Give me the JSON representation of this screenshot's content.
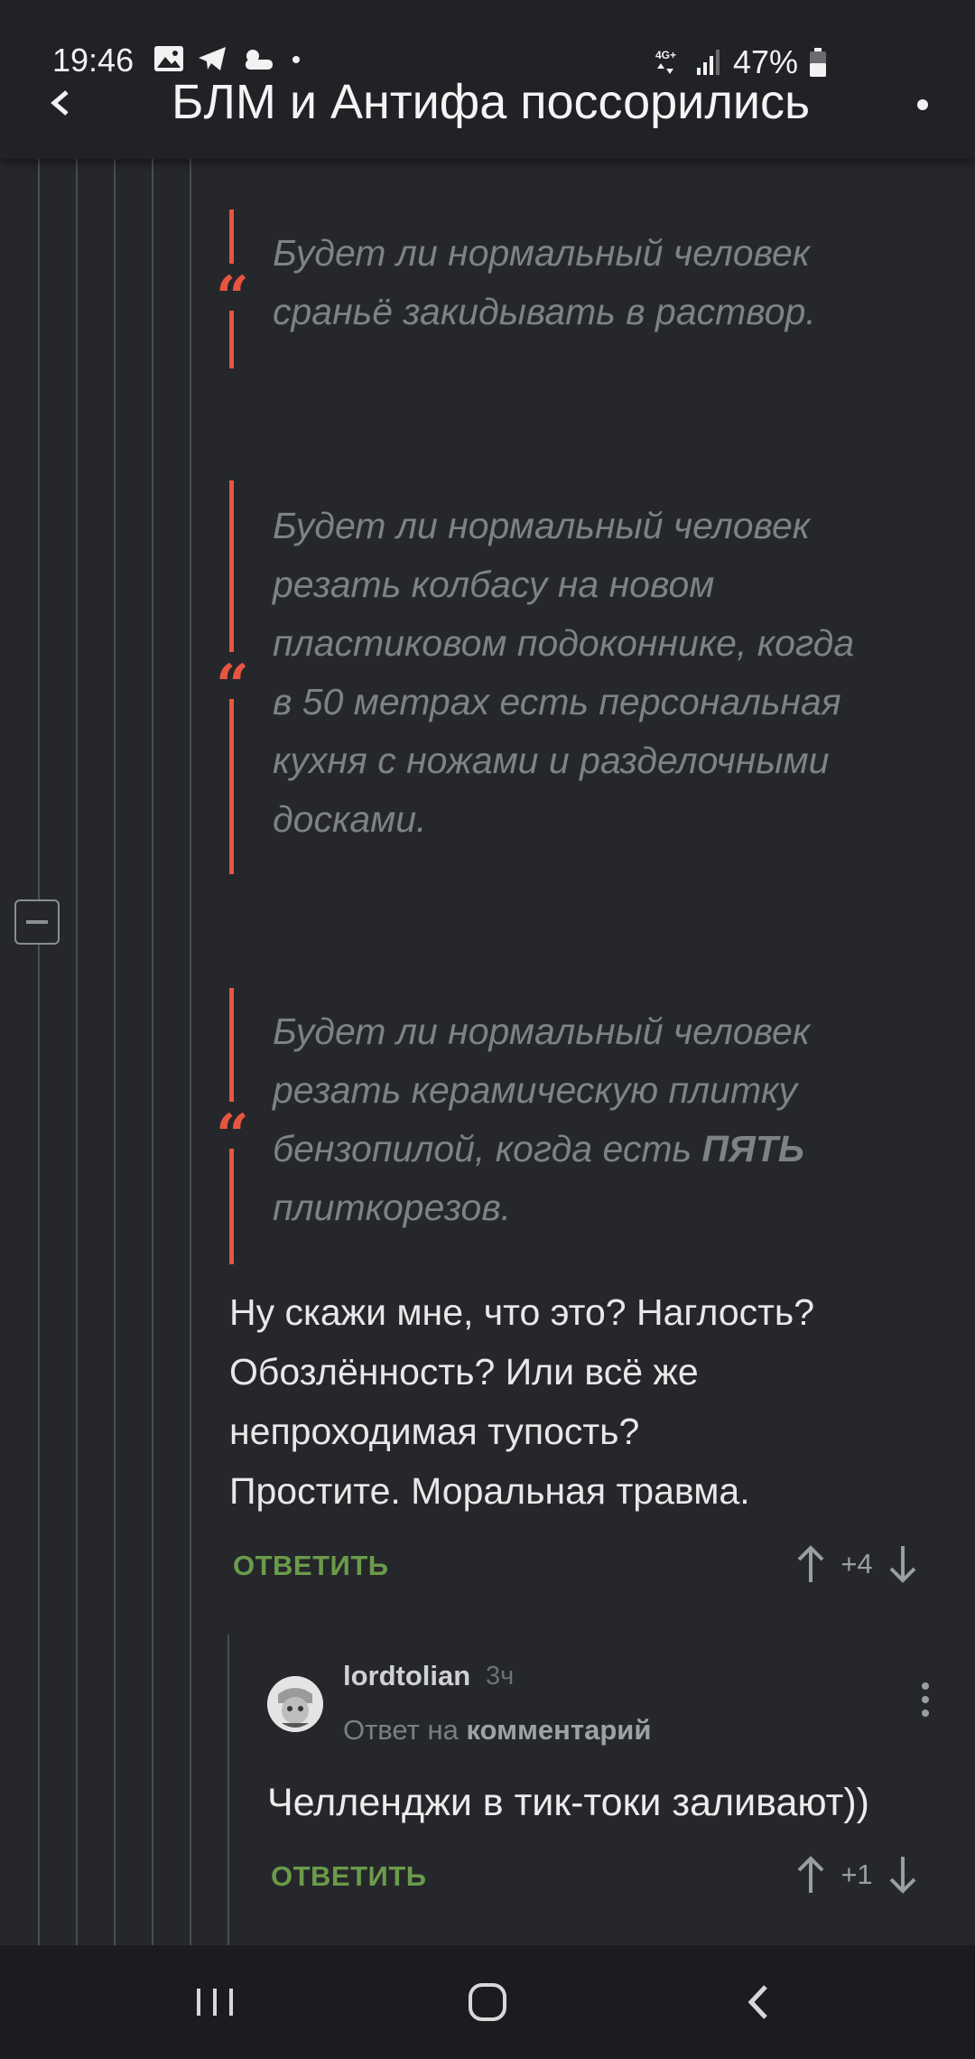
{
  "status_bar": {
    "time": "19:46",
    "network": "4G+",
    "battery": "47%"
  },
  "app_bar": {
    "title": "БЛМ и Антифа поссорились",
    "back_icon": "chevron-left-icon",
    "more_icon": "more-vert-icon"
  },
  "quotes": [
    {
      "lines": [
        "Будет ли нормальный человек",
        "сраньё закидывать в раствор."
      ]
    },
    {
      "lines": [
        "Будет ли нормальный человек",
        "резать колбасу на новом",
        "пластиковом подоконнике, когда",
        "в 50 метрах есть персональная",
        "кухня с ножами и разделочными",
        "досками."
      ]
    },
    {
      "line1": "Будет ли нормальный человек",
      "line2": "резать керамическую плитку",
      "line3_pre": "бензопилой, когда есть ",
      "line3_bold": "ПЯТЬ",
      "line4": "плиткорезов."
    }
  ],
  "comment": {
    "lines": [
      "Ну скажи мне, что это? Наглость?",
      "Обозлённость? Или всё же",
      "непроходимая тупость?",
      "Простите. Моральная травма."
    ],
    "reply_label": "ОТВЕТИТЬ",
    "score": "+4"
  },
  "reply": {
    "username": "lordtolian",
    "time_ago": "3ч",
    "reply_to_prefix": "Ответ на ",
    "reply_to_link": "комментарий",
    "text": "Челленджи в тик-токи заливают))",
    "reply_label": "ОТВЕТИТЬ",
    "score": "+1"
  },
  "colors": {
    "background": "#25272b",
    "quote_accent": "#e8553e",
    "reply_green": "#6b9b4a"
  }
}
